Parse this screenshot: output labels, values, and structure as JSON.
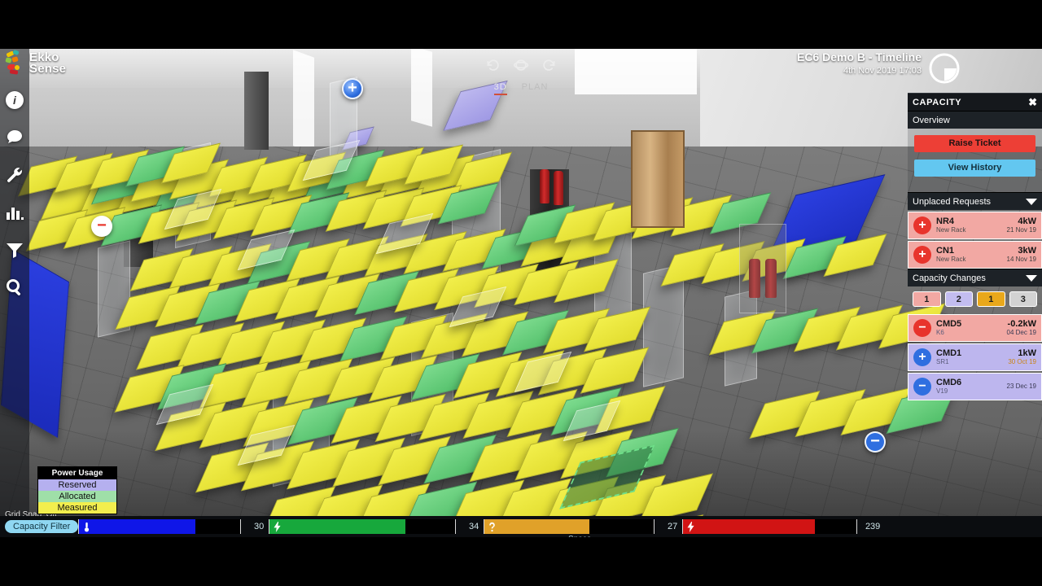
{
  "brand": {
    "line1": "Ekko",
    "line2": "Sense"
  },
  "header": {
    "title": "EC6 Demo B - Timeline",
    "timestamp": "4th Nov 2019 17:03",
    "donut_icon": "pie-chart-icon"
  },
  "view_toggle": {
    "icons": [
      "rotate-left-icon",
      "orbit-icon",
      "rotate-right-icon"
    ],
    "options": [
      {
        "label": "3D",
        "active": true
      },
      {
        "label": "PLAN",
        "active": false
      }
    ]
  },
  "toolbar": {
    "items": [
      {
        "name": "info-icon",
        "label": "Info"
      },
      {
        "name": "comment-icon",
        "label": "Comments"
      },
      {
        "name": "wrench-icon",
        "label": "Settings"
      },
      {
        "name": "bar-chart-icon",
        "label": "Reports"
      },
      {
        "name": "filter-icon",
        "label": "Filter"
      },
      {
        "name": "search-icon",
        "label": "Search"
      }
    ]
  },
  "panel": {
    "title": "CAPACITY",
    "close_label": "✖",
    "overview": {
      "title": "Overview",
      "raise_ticket_label": "Raise Ticket",
      "view_history_label": "View History"
    },
    "unplaced_requests": {
      "title": "Unplaced Requests",
      "items": [
        {
          "sign": "+",
          "name": "NR4",
          "sub": "New Rack",
          "value": "4kW",
          "date": "21 Nov 19",
          "tone": "red",
          "circle": "r"
        },
        {
          "sign": "+",
          "name": "CN1",
          "sub": "New Rack",
          "value": "3kW",
          "date": "14 Nov 19",
          "tone": "red",
          "circle": "r"
        }
      ]
    },
    "capacity_changes": {
      "title": "Capacity Changes",
      "badges": [
        {
          "count": "1",
          "tone": "b1"
        },
        {
          "count": "2",
          "tone": "b2"
        },
        {
          "count": "1",
          "tone": "b3"
        },
        {
          "count": "3",
          "tone": "b4"
        }
      ],
      "items": [
        {
          "sign": "−",
          "name": "CMD5",
          "sub": "K6",
          "value": "-0.2kW",
          "date": "04 Dec 19",
          "tone": "red",
          "circle": "r",
          "date_tone": ""
        },
        {
          "sign": "+",
          "name": "CMD1",
          "sub": "SR1",
          "value": "1kW",
          "date": "30 Oct 19",
          "tone": "purple",
          "circle": "b",
          "date_tone": "orange"
        },
        {
          "sign": "−",
          "name": "CMD6",
          "sub": "V19",
          "value": "",
          "date": "23 Dec 19",
          "tone": "purple",
          "circle": "b",
          "date_tone": ""
        }
      ]
    }
  },
  "legend": {
    "title": "Power Usage",
    "items": [
      {
        "label": "Reserved",
        "color": "#b5b0ef"
      },
      {
        "label": "Allocated",
        "color": "#9fdfa8"
      },
      {
        "label": "Measured",
        "color": "#f2ee4e"
      }
    ]
  },
  "grid_snap": {
    "label": "Grid Snap: Off"
  },
  "filter_bar": {
    "chip_label": "Capacity Filter",
    "space_label": "Space",
    "gauges": [
      {
        "icon": "thermometer-icon",
        "color": "#0f16e8",
        "value": "30",
        "fill_pct": 72
      },
      {
        "icon": "bolt-icon",
        "color": "#17a83c",
        "value": "34",
        "fill_pct": 73
      },
      {
        "icon": "space-icon",
        "color": "#e0a129",
        "value": "27",
        "fill_pct": 62
      },
      {
        "icon": "bolt-icon",
        "color": "#d11414",
        "value": "239",
        "fill_pct": 76
      }
    ]
  },
  "scene_markers": [
    {
      "name": "marker-plus-blue",
      "glyph": "+"
    },
    {
      "name": "marker-minus-red",
      "glyph": "−"
    },
    {
      "name": "marker-minus-blue",
      "glyph": "−"
    }
  ]
}
